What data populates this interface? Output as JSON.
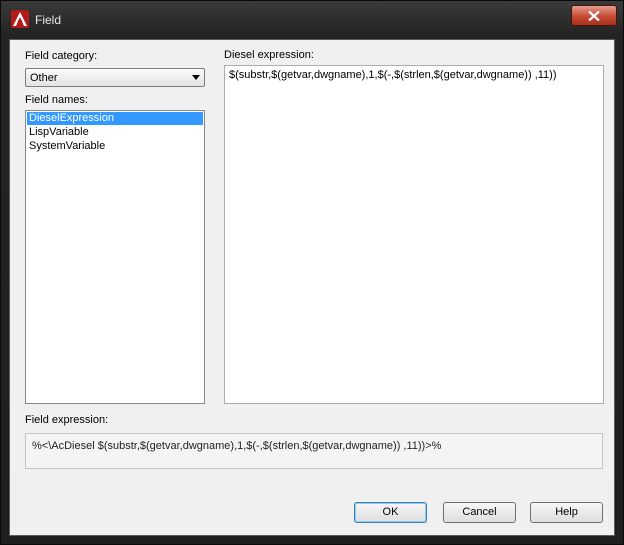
{
  "window": {
    "title": "Field"
  },
  "field_category": {
    "label": "Field category:",
    "selected": "Other"
  },
  "field_names": {
    "label": "Field names:",
    "items": [
      "DieselExpression",
      "LispVariable",
      "SystemVariable"
    ],
    "selected_index": 0
  },
  "diesel": {
    "label": "Diesel expression:",
    "value": "$(substr,$(getvar,dwgname),1,$(-,$(strlen,$(getvar,dwgname)) ,11))"
  },
  "field_expression": {
    "label": "Field expression:",
    "value": "%<\\AcDiesel $(substr,$(getvar,dwgname),1,$(-,$(strlen,$(getvar,dwgname)) ,11))>%"
  },
  "buttons": {
    "ok": "OK",
    "cancel": "Cancel",
    "help": "Help"
  },
  "icons": {
    "app": "autocad-logo-icon",
    "close": "close-icon",
    "dropdown": "chevron-down-icon"
  },
  "colors": {
    "selection": "#3399ff",
    "close_button": "#c74a33",
    "titlebar": "#2b2b2b"
  }
}
